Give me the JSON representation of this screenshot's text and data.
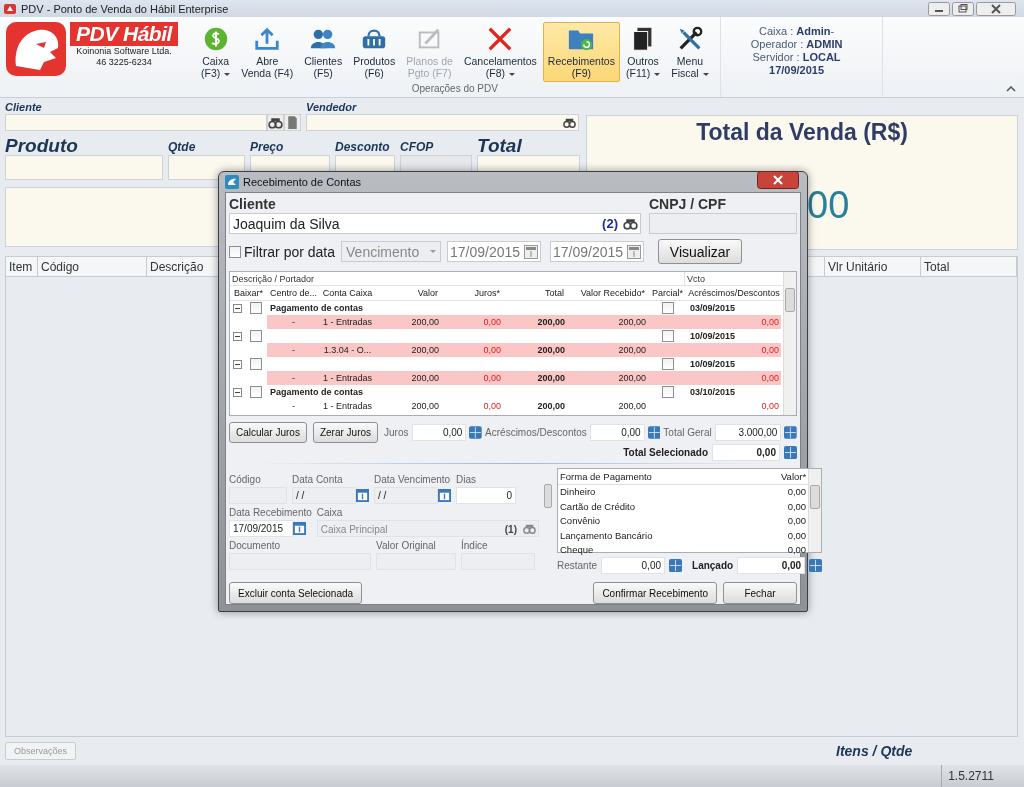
{
  "window": {
    "title": "PDV - Ponto de Venda do Hábil Enterprise"
  },
  "brand": {
    "name": "PDV Hábil",
    "company": "Koinonia Software Ltda.",
    "phone": "46 3225-6234"
  },
  "ribbon": {
    "group_label": "Operações do PDV",
    "buttons": [
      {
        "line1": "Caixa",
        "line2": "(F3)",
        "dropdown": true,
        "disabled": false,
        "selected": false
      },
      {
        "line1": "Abre",
        "line2": "Venda (F4)",
        "dropdown": false,
        "disabled": false,
        "selected": false
      },
      {
        "line1": "Clientes",
        "line2": "(F5)",
        "dropdown": false,
        "disabled": false,
        "selected": false
      },
      {
        "line1": "Produtos",
        "line2": "(F6)",
        "dropdown": false,
        "disabled": false,
        "selected": false
      },
      {
        "line1": "Planos de",
        "line2": "Pgto (F7)",
        "dropdown": false,
        "disabled": true,
        "selected": false
      },
      {
        "line1": "Cancelamentos",
        "line2": "(F8)",
        "dropdown": true,
        "disabled": false,
        "selected": false
      },
      {
        "line1": "Recebimentos",
        "line2": "(F9)",
        "dropdown": false,
        "disabled": false,
        "selected": true
      },
      {
        "line1": "Outros",
        "line2": "(F11)",
        "dropdown": true,
        "disabled": false,
        "selected": false
      },
      {
        "line1": "Menu",
        "line2": "Fiscal",
        "dropdown": true,
        "disabled": false,
        "selected": false
      }
    ]
  },
  "session": {
    "lines": [
      {
        "label": "Caixa :",
        "value": "Admin",
        "suffix": "-"
      },
      {
        "label": "Operador :",
        "value": "ADMIN"
      },
      {
        "label": "Servidor :",
        "value": "LOCAL"
      }
    ],
    "date": "17/09/2015"
  },
  "sale_form": {
    "cliente_label": "Cliente",
    "vendedor_label": "Vendedor",
    "produto_label": "Produto",
    "qtde_label": "Qtde",
    "preco_label": "Preço",
    "desconto_label": "Desconto",
    "cfop_label": "CFOP",
    "total_label": "Total"
  },
  "sale_total": {
    "title": "Total da Venda (R$)",
    "value": "00"
  },
  "items_table": {
    "columns": [
      "Item",
      "Código",
      "Descrição",
      "Vlr Unitário",
      "Total"
    ]
  },
  "footer": {
    "observacoes": "Observações",
    "itens_label": "Itens / Qtde"
  },
  "status_bar": {
    "version": "1.5.2711"
  },
  "dialog": {
    "title": "Recebimento de Contas",
    "cliente_label": "Cliente",
    "cliente": "Joaquim da Silva",
    "cliente_count": "(2)",
    "cnpj_label": "CNPJ / CPF",
    "filter": {
      "label": "Filtrar por data",
      "checked": false,
      "field": "Vencimento",
      "date_from": "17/09/2015",
      "date_to": "17/09/2015"
    },
    "visualizar": "Visualizar",
    "grid": {
      "group_headers": [
        "Descrição / Portador",
        "Vcto"
      ],
      "columns": [
        "Baixar*",
        "Centro de...",
        "Conta Caixa",
        "Valor",
        "Juros*",
        "Total",
        "Valor Recebido*",
        "Parcial*",
        "Acréscimos/Descontos"
      ],
      "groups": [
        {
          "expanded": true,
          "checked": false,
          "description": "Pagamento de contas",
          "parcial": false,
          "vcto": "03/09/2015",
          "row": {
            "centro": "-",
            "conta": "1 - Entradas",
            "valor": "200,00",
            "juros": "0,00",
            "total": "200,00",
            "recebido": "200,00",
            "acrescimos": "0,00",
            "highlighted": true
          }
        },
        {
          "expanded": true,
          "checked": false,
          "parcial": false,
          "vcto": "10/09/2015",
          "row": {
            "centro": "-",
            "conta": "1.3.04 - O...",
            "valor": "200,00",
            "juros": "0,00",
            "total": "200,00",
            "recebido": "200,00",
            "acrescimos": "0,00",
            "highlighted": true
          }
        },
        {
          "expanded": true,
          "checked": false,
          "parcial": false,
          "vcto": "10/09/2015",
          "row": {
            "centro": "-",
            "conta": "1 - Entradas",
            "valor": "200,00",
            "juros": "0,00",
            "total": "200,00",
            "recebido": "200,00",
            "acrescimos": "0,00",
            "highlighted": true
          }
        },
        {
          "expanded": true,
          "checked": false,
          "description": "Pagamento de contas",
          "parcial": false,
          "vcto": "03/10/2015",
          "row": {
            "centro": "-",
            "conta": "1 - Entradas",
            "valor": "200,00",
            "juros": "0,00",
            "total": "200,00",
            "recebido": "200,00",
            "acrescimos": "0,00",
            "highlighted": false
          }
        }
      ]
    },
    "calc_buttons": [
      "Calcular Juros",
      "Zerar Juros"
    ],
    "juros_label": "Juros",
    "juros": "0,00",
    "acrescimos_label": "Acréscimos/Descontos",
    "acrescimos": "0,00",
    "total_geral_label": "Total Geral",
    "total_geral": "3.000,00",
    "total_selecionado_label": "Total Selecionado",
    "total_selecionado": "0,00",
    "codigo_label": "Código",
    "data_conta_label": "Data Conta",
    "data_conta": " / /",
    "data_venc_label": "Data Vencimento",
    "data_venc": " / /",
    "dias_label": "Dias",
    "dias": "0",
    "data_receb_label": "Data Recebimento",
    "data_receb": "17/09/2015",
    "caixa_label": "Caixa",
    "caixa": "Caixa Principal",
    "caixa_count": "(1)",
    "documento_label": "Documento",
    "valor_original_label": "Valor Original",
    "indice_label": "Índice",
    "payments": {
      "columns": [
        "Forma de Pagamento",
        "Valor*"
      ],
      "rows": [
        {
          "name": "Dinheiro",
          "value": "0,00"
        },
        {
          "name": "Cartão de Crédito",
          "value": "0,00"
        },
        {
          "name": "Convênio",
          "value": "0,00"
        },
        {
          "name": "Lançamento Bancário",
          "value": "0,00"
        },
        {
          "name": "Cheque",
          "value": "0,00"
        }
      ]
    },
    "restante_label": "Restante",
    "restante": "0,00",
    "lancado_label": "Lançado",
    "lancado": "0,00",
    "excluir": "Excluir conta Selecionada",
    "confirmar": "Confirmar Recebimento",
    "fechar": "Fechar"
  }
}
